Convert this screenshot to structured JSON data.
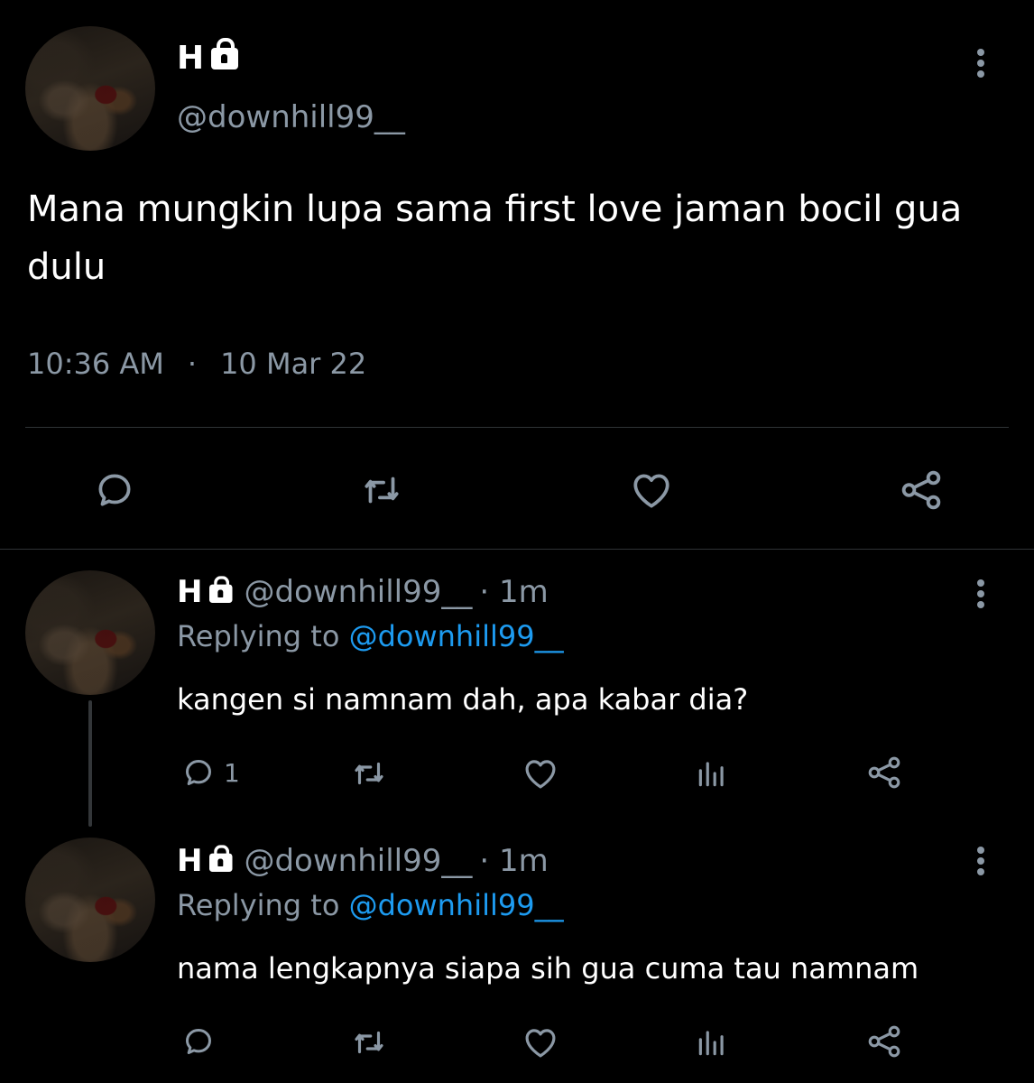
{
  "main_tweet": {
    "author_name": "H",
    "author_handle": "@downhill99__",
    "text": "Mana mungkin lupa sama first love jaman bocil gua dulu",
    "time": "10:36 AM",
    "date": "10 Mar 22",
    "actions": [
      "reply-icon",
      "retweet-icon",
      "like-icon",
      "share-icon"
    ]
  },
  "replies": [
    {
      "author_name": "H",
      "author_handle": "@downhill99__",
      "age": "· 1m",
      "replying_to_label": "Replying to",
      "replying_to_handle": "@downhill99__",
      "text": "kangen si namnam dah, apa kabar dia?",
      "reply_count": "1"
    },
    {
      "author_name": "H",
      "author_handle": "@downhill99__",
      "age": "· 1m",
      "replying_to_label": "Replying to",
      "replying_to_handle": "@downhill99__",
      "text": "nama lengkapnya siapa sih gua cuma tau namnam",
      "reply_count": ""
    }
  ],
  "colors": {
    "background": "#000000",
    "text": "#ffffff",
    "muted": "#8b98a5",
    "link": "#1d9bf0"
  }
}
